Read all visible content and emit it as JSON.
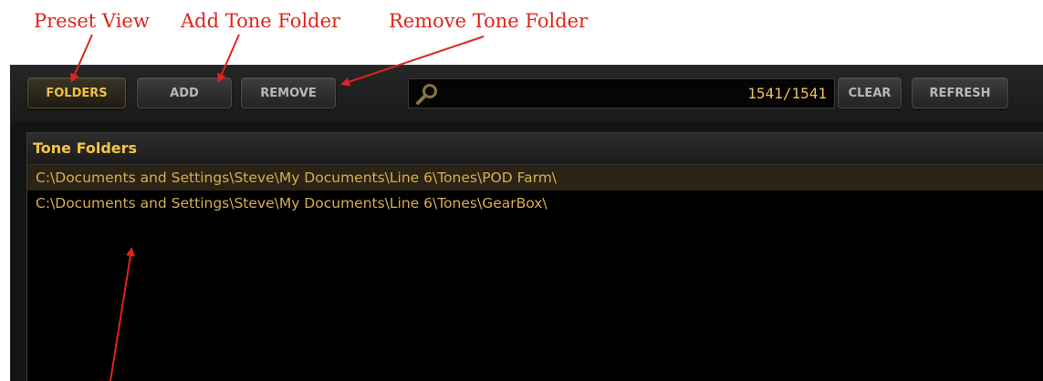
{
  "callouts": {
    "preset_view": "Preset View",
    "add_tone_folder": "Add Tone Folder",
    "remove_tone_folder": "Remove Tone Folder"
  },
  "toolbar": {
    "folders_label": "FOLDERS",
    "add_label": "ADD",
    "remove_label": "REMOVE",
    "clear_label": "CLEAR",
    "refresh_label": "REFRESH"
  },
  "search": {
    "value": "",
    "count": "1541/1541",
    "icon": "search-icon"
  },
  "tone_folders": {
    "header": "Tone Folders",
    "rows": [
      "C:\\Documents and Settings\\Steve\\My Documents\\Line 6\\Tones\\POD Farm\\",
      "C:\\Documents and Settings\\Steve\\My Documents\\Line 6\\Tones\\GearBox\\"
    ],
    "selected_index": 0
  },
  "colors": {
    "callout": "#e0241b",
    "accent": "#f4c542",
    "row_text": "#d9ad4c",
    "selected_row": "#2a2316",
    "panel_bg": "#141414",
    "list_bg": "#000000"
  }
}
